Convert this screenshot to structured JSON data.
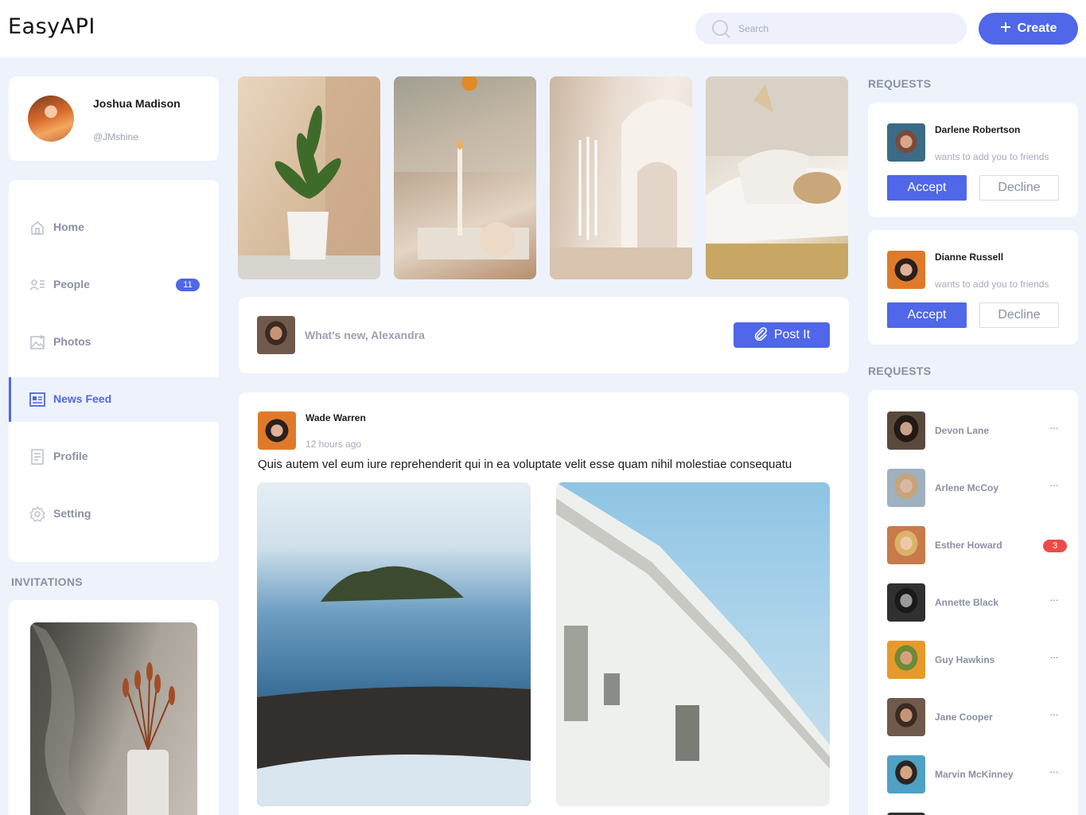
{
  "app": {
    "logo": "EasyAPI"
  },
  "header": {
    "search_placeholder": "Search",
    "create_label": "Create"
  },
  "profile": {
    "name": "Joshua Madison",
    "handle": "@JMshine"
  },
  "nav": {
    "items": [
      {
        "label": "Home",
        "icon": "home-icon"
      },
      {
        "label": "People",
        "icon": "people-icon",
        "badge": "11"
      },
      {
        "label": "Photos",
        "icon": "photos-icon"
      },
      {
        "label": "News Feed",
        "icon": "news-feed-icon",
        "active": true
      },
      {
        "label": "Profile",
        "icon": "profile-icon"
      },
      {
        "label": "Setting",
        "icon": "gear-icon"
      }
    ]
  },
  "invitations": {
    "title": "INVITATIONS"
  },
  "composer": {
    "placeholder": "What's new, Alexandra",
    "post_label": "Post It"
  },
  "post": {
    "author": "Wade Warren",
    "time": "12 hours ago",
    "text": "Quis autem vel eum iure reprehenderit qui in ea voluptate velit esse quam nihil molestiae consequatu"
  },
  "requests": {
    "title": "REQUESTS",
    "items": [
      {
        "name": "Darlene Robertson",
        "message": "wants to add you to friends",
        "accept": "Accept",
        "decline": "Decline"
      },
      {
        "name": "Dianne Russell",
        "message": "wants to add you to friends",
        "accept": "Accept",
        "decline": "Decline"
      }
    ]
  },
  "contacts": {
    "title": "REQUESTS",
    "more": "···",
    "items": [
      {
        "name": "Devon Lane"
      },
      {
        "name": "Arlene McCoy"
      },
      {
        "name": "Esther Howard",
        "badge": "3"
      },
      {
        "name": "Annette Black"
      },
      {
        "name": "Guy Hawkins"
      },
      {
        "name": "Jane Cooper"
      },
      {
        "name": "Marvin McKinney"
      }
    ]
  },
  "colors": {
    "accent": "#4f67e8",
    "background": "#eef2fa",
    "muted_text": "#8a90a3",
    "alert": "#ef4a4a"
  }
}
